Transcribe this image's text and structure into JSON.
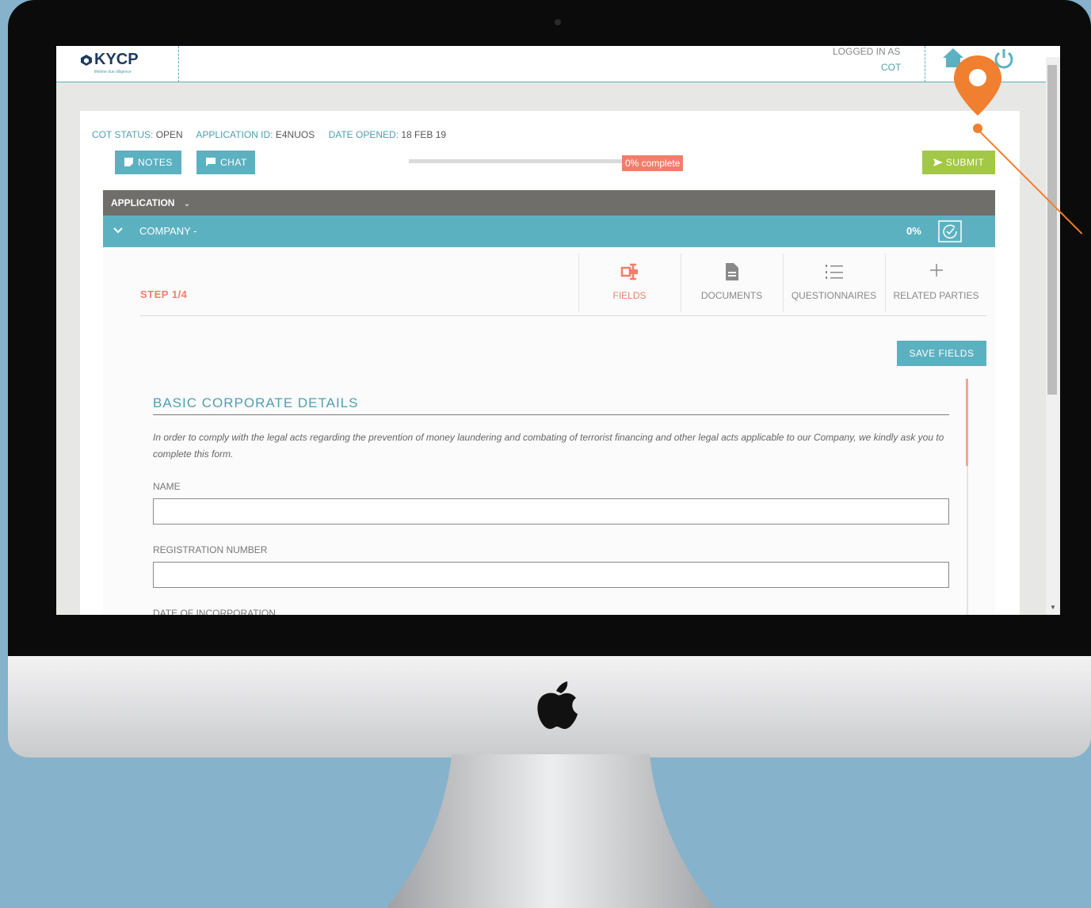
{
  "header": {
    "logo_text": "KYCP",
    "logo_tagline": "lifetime due diligence",
    "logged_in_label": "LOGGED IN AS",
    "logged_in_user": "COT"
  },
  "meta": {
    "status_key": "COT STATUS:",
    "status_value": "OPEN",
    "app_id_key": "APPLICATION ID:",
    "app_id_value": "E4NUOS",
    "date_key": "DATE OPENED:",
    "date_value": "18 FEB 19"
  },
  "toolbar": {
    "notes_label": "NOTES",
    "chat_label": "CHAT",
    "progress_percent": 0,
    "progress_text": "0% complete",
    "submit_label": "SUBMIT"
  },
  "application": {
    "title": "APPLICATION"
  },
  "company": {
    "title": "COMPANY -",
    "percent": "0%"
  },
  "steps": {
    "label": "STEP 1/4",
    "tabs": [
      {
        "label": "FIELDS",
        "icon": "fields-icon"
      },
      {
        "label": "DOCUMENTS",
        "icon": "document-icon"
      },
      {
        "label": "QUESTIONNAIRES",
        "icon": "list-icon"
      },
      {
        "label": "RELATED PARTIES",
        "icon": "plus-icon"
      }
    ],
    "active_tab": "FIELDS"
  },
  "form": {
    "save_label": "SAVE FIELDS",
    "section_title": "BASIC CORPORATE DETAILS",
    "intro": "In order to comply with the legal acts regarding the prevention of money laundering and combating of terrorist financing and other legal acts applicable to our Company, we kindly ask you to complete this form.",
    "fields": [
      {
        "label": "NAME",
        "value": ""
      },
      {
        "label": "REGISTRATION NUMBER",
        "value": ""
      },
      {
        "label": "DATE OF INCORPORATION"
      }
    ]
  },
  "colors": {
    "teal": "#5cb1c1",
    "coral": "#ef7f6a",
    "green": "#a3c746",
    "dark_bar": "#706e6b",
    "pin_orange": "#f07f2f",
    "background": "#86b3cb"
  }
}
